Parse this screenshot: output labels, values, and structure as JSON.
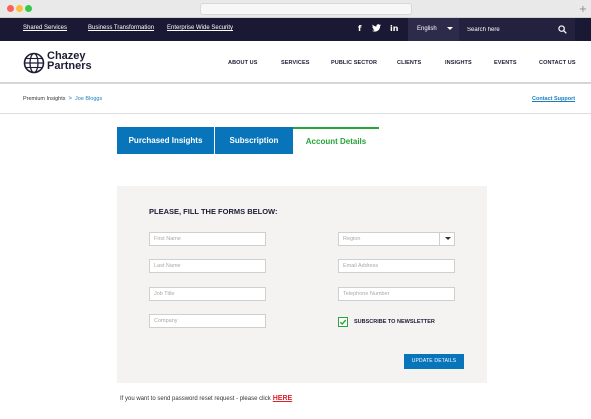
{
  "topbar": {
    "links": [
      "Shared Services",
      "Business Transformation",
      "Enterprise Wide Security"
    ],
    "social": [
      {
        "icon": "facebook-icon",
        "glyph": "f"
      },
      {
        "icon": "twitter-icon",
        "glyph": "𝕥"
      },
      {
        "icon": "linkedin-icon",
        "glyph": "in"
      }
    ],
    "language": "English",
    "search_placeholder": "Search here"
  },
  "header": {
    "logo_line1": "Chazey",
    "logo_line2": "Partners",
    "nav": [
      "ABOUT US",
      "SERVICES",
      "PUBLIC SECTOR",
      "CLIENTS",
      "INSIGHTS",
      "EVENTS",
      "CONTACT US"
    ]
  },
  "breadcrumb": {
    "root": "Premium Insights",
    "separator": ">",
    "current": "Joe Bloggs"
  },
  "contact_support": "Contact Support",
  "tabs": [
    "Purchased Insights",
    "Subscription",
    "Account Details"
  ],
  "form": {
    "title": "PLEASE, FILL THE FORMS BELOW:",
    "first_name_placeholder": "First Name",
    "last_name_placeholder": "Last Name",
    "job_title_placeholder": "Job Title",
    "company_placeholder": "Company",
    "region_placeholder": "Region",
    "email_placeholder": "Email Address",
    "phone_placeholder": "Telephone Number",
    "newsletter_label": "SUBSCRIBE TO NEWSLETTER",
    "newsletter_checked": true,
    "submit_label": "UPDATE DETAILS"
  },
  "reset": {
    "text": "If you want to send password reset request - please click",
    "link": "HERE"
  },
  "colors": {
    "topbar": "#191934",
    "brand_blue": "#0875bb",
    "active_green": "#26a53a",
    "link_red": "#e2222b"
  }
}
